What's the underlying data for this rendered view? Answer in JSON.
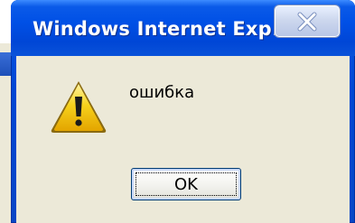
{
  "dialog": {
    "title": "Windows Internet Exp...",
    "message": "ошибка",
    "icon": "warning-icon",
    "ok_label": "OK",
    "close_icon": "close-icon"
  },
  "colors": {
    "titlebar": "#0050e6",
    "client_bg": "#ece9d8",
    "warning_yellow": "#f5c400",
    "close_x": "#ffffff"
  }
}
